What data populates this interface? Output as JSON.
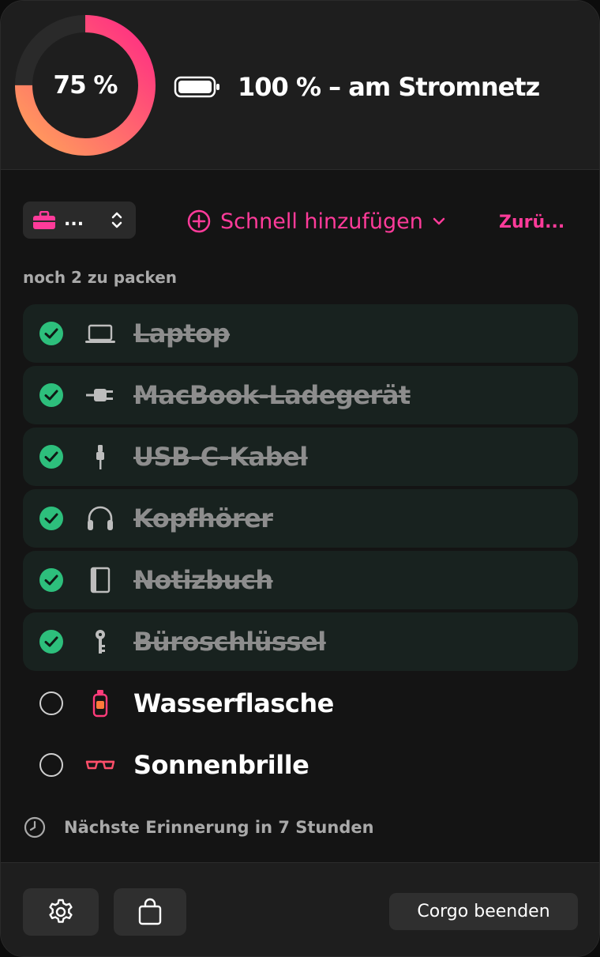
{
  "header": {
    "battery_percent": 75,
    "ring_label": "75 %",
    "status": "100 % – am Stromnetz",
    "ring_colors": {
      "start": "#ffa15a",
      "end": "#ff2b84",
      "track": "#2a2a2a"
    },
    "battery_icon": "battery-full-icon"
  },
  "toolbar": {
    "profile_icon": "briefcase-icon",
    "profile_value": "...",
    "quick_add_label": "Schnell hinzufügen",
    "back_label": "Zurü...",
    "accent": "#ff3b9a"
  },
  "remaining_text": "noch 2 zu packen",
  "items": [
    {
      "label": "Laptop",
      "icon": "laptop-icon",
      "packed": true
    },
    {
      "label": "MacBook-Ladegerät",
      "icon": "plug-icon",
      "packed": true
    },
    {
      "label": "USB-C-Kabel",
      "icon": "cable-icon",
      "packed": true
    },
    {
      "label": "Kopfhörer",
      "icon": "headphones-icon",
      "packed": true
    },
    {
      "label": "Notizbuch",
      "icon": "notebook-icon",
      "packed": true
    },
    {
      "label": "Büroschlüssel",
      "icon": "key-icon",
      "packed": true
    },
    {
      "label": "Wasserflasche",
      "icon": "water-bottle-icon",
      "packed": false
    },
    {
      "label": "Sonnenbrille",
      "icon": "sunglasses-icon",
      "packed": false
    }
  ],
  "check_color": "#2dbf7c",
  "reminder_text": "Nächste Erinnerung in 7 Stunden",
  "footer": {
    "settings_icon": "gear-icon",
    "bag_icon": "shopping-bag-icon",
    "quit_label": "Corgo beenden"
  }
}
